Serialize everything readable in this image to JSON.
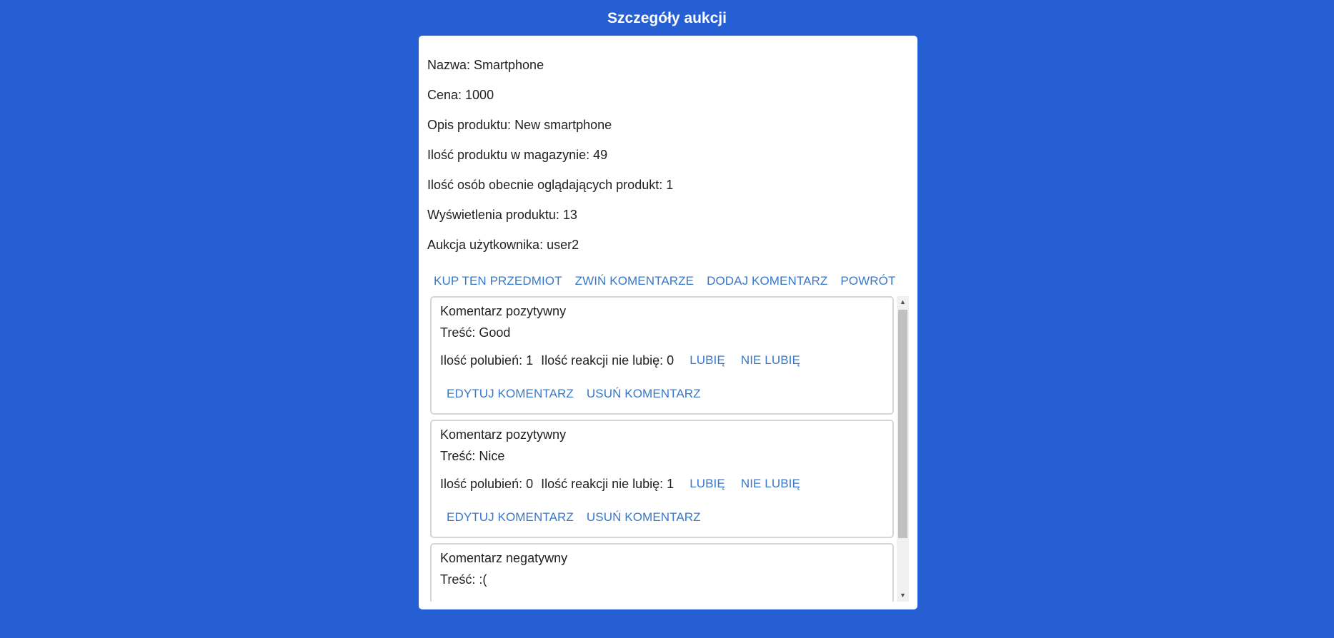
{
  "header": {
    "title": "Szczegóły aukcji"
  },
  "details": {
    "name": "Nazwa: Smartphone",
    "price": "Cena: 1000",
    "description": "Opis produktu: New smartphone",
    "stock": "Ilość produktu w magazynie: 49",
    "viewers_now": "Ilość osób obecnie oglądających produkt: 1",
    "views": "Wyświetlenia produktu: 13",
    "owner": "Aukcja użytkownika: user2"
  },
  "actions": {
    "buy": "KUP TEN PRZEDMIOT",
    "collapse_comments": "ZWIŃ KOMENTARZE",
    "add_comment": "DODAJ KOMENTARZ",
    "back": "POWRÓT"
  },
  "comments": [
    {
      "kind": "Komentarz pozytywny",
      "text": "Treść: Good",
      "likes": "Ilość polubień: 1",
      "dislikes": "Ilość reakcji nie lubię: 0",
      "like_label": "LUBIĘ",
      "dislike_label": "NIE LUBIĘ",
      "edit_label": "EDYTUJ KOMENTARZ",
      "delete_label": "USUŃ KOMENTARZ"
    },
    {
      "kind": "Komentarz pozytywny",
      "text": "Treść: Nice",
      "likes": "Ilość polubień: 0",
      "dislikes": "Ilość reakcji nie lubię: 1",
      "like_label": "LUBIĘ",
      "dislike_label": "NIE LUBIĘ",
      "edit_label": "EDYTUJ KOMENTARZ",
      "delete_label": "USUŃ KOMENTARZ"
    },
    {
      "kind": "Komentarz negatywny",
      "text": "Treść: :("
    }
  ],
  "scrollbar": {
    "up_icon": "chevron-up-icon",
    "down_icon": "chevron-down-icon"
  },
  "colors": {
    "background": "#265ed4",
    "accent": "#3878c9",
    "card": "#ffffff"
  }
}
